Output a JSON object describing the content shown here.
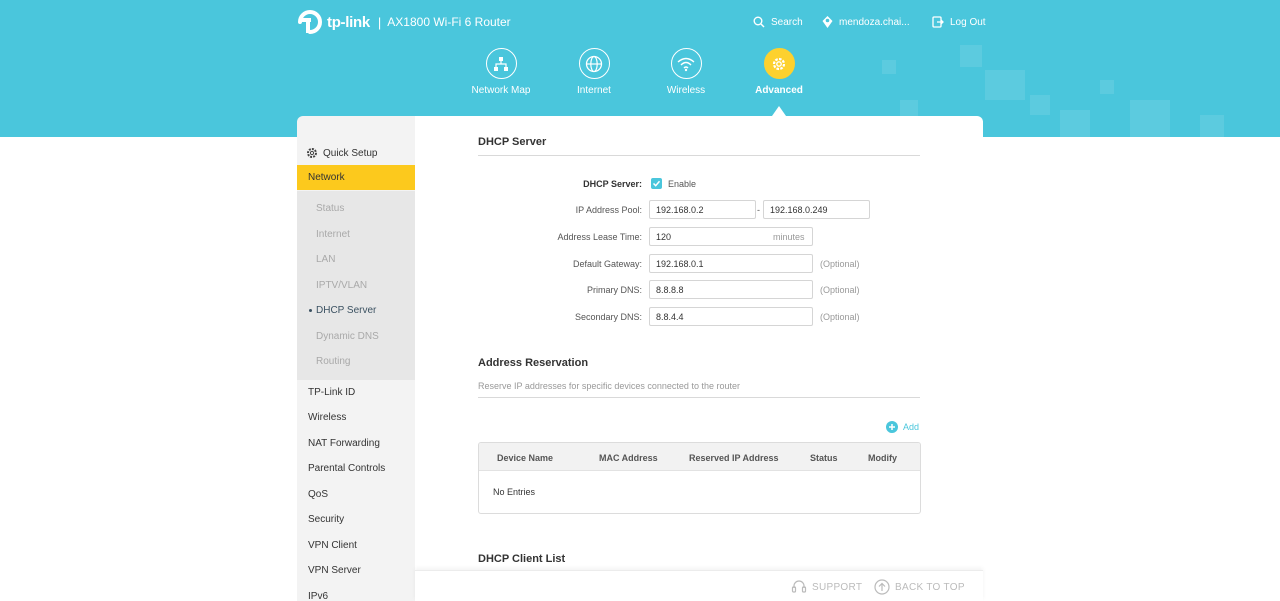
{
  "header": {
    "brand": "tp-link",
    "separator": "|",
    "model": "AX1800 Wi-Fi 6 Router",
    "search_label": "Search",
    "user_label": "mendoza.chai...",
    "logout_label": "Log Out",
    "bg_color": "#4ac6dc",
    "accent_color": "#fdd12e"
  },
  "nav": {
    "items": [
      {
        "label": "Network Map",
        "icon": "network-map-icon"
      },
      {
        "label": "Internet",
        "icon": "globe-icon"
      },
      {
        "label": "Wireless",
        "icon": "wifi-icon"
      },
      {
        "label": "Advanced",
        "icon": "gear-icon",
        "active": true
      }
    ]
  },
  "sidebar": {
    "quick_setup": "Quick Setup",
    "network": "Network",
    "network_sub": [
      {
        "label": "Status"
      },
      {
        "label": "Internet"
      },
      {
        "label": "LAN"
      },
      {
        "label": "IPTV/VLAN"
      },
      {
        "label": "DHCP Server",
        "active": true
      },
      {
        "label": "Dynamic DNS"
      },
      {
        "label": "Routing"
      }
    ],
    "items": [
      "TP-Link ID",
      "Wireless",
      "NAT Forwarding",
      "Parental Controls",
      "QoS",
      "Security",
      "VPN Client",
      "VPN Server",
      "IPv6"
    ]
  },
  "dhcp": {
    "title": "DHCP Server",
    "server_label": "DHCP Server:",
    "enable_label": "Enable",
    "enabled": true,
    "pool_label": "IP Address Pool:",
    "pool_start": "192.168.0.2",
    "pool_dash": "-",
    "pool_end": "192.168.0.249",
    "lease_label": "Address Lease Time:",
    "lease_value": "120",
    "lease_unit": "minutes",
    "gateway_label": "Default Gateway:",
    "gateway_value": "192.168.0.1",
    "primary_dns_label": "Primary DNS:",
    "primary_dns_value": "8.8.8.8",
    "secondary_dns_label": "Secondary DNS:",
    "secondary_dns_value": "8.8.4.4",
    "optional_label": "(Optional)"
  },
  "reservation": {
    "title": "Address Reservation",
    "description": "Reserve IP addresses for specific devices connected to the router",
    "add_label": "Add",
    "columns": [
      "Device Name",
      "MAC Address",
      "Reserved IP Address",
      "Status",
      "Modify"
    ],
    "empty_text": "No Entries"
  },
  "client_list": {
    "title": "DHCP Client List"
  },
  "footer": {
    "support": "SUPPORT",
    "back_to_top": "BACK TO TOP"
  }
}
